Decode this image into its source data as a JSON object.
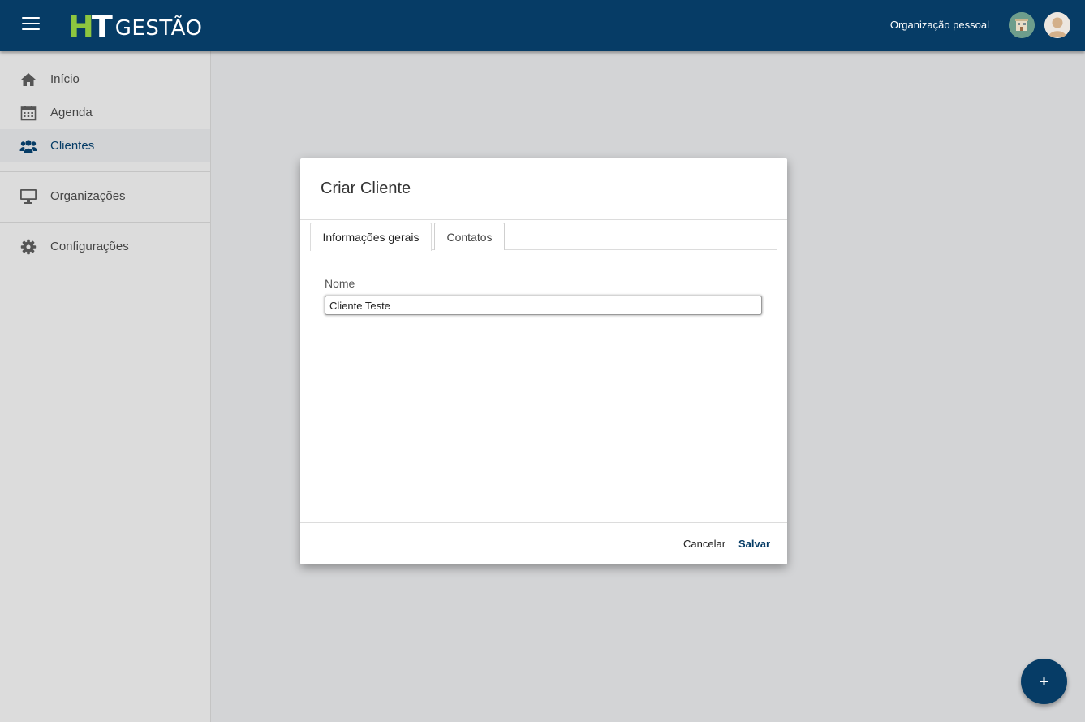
{
  "header": {
    "logo": {
      "part1": "H",
      "part2": "T",
      "part3": "GESTÃO"
    },
    "organization_label": "Organização pessoal",
    "icons": [
      "menu-icon",
      "organization-avatar",
      "user-avatar"
    ]
  },
  "sidebar": {
    "items": [
      {
        "label": "Início",
        "icon": "home-icon"
      },
      {
        "label": "Agenda",
        "icon": "calendar-icon"
      },
      {
        "label": "Clientes",
        "icon": "users-icon",
        "active": true
      },
      {
        "label": "Organizações",
        "icon": "monitor-icon"
      },
      {
        "label": "Configurações",
        "icon": "gear-icon"
      }
    ]
  },
  "dialog": {
    "title": "Criar Cliente",
    "tabs": [
      {
        "label": "Informações gerais",
        "active": true
      },
      {
        "label": "Contatos",
        "active": false
      }
    ],
    "field": {
      "label": "Nome",
      "value": "Cliente Teste"
    },
    "actions": {
      "cancel": "Cancelar",
      "save": "Salvar"
    }
  },
  "fab": {
    "label": "+",
    "icon": "plus-icon"
  },
  "colors": {
    "primary": "#063c66",
    "accent_green": "#8dc63f",
    "background": "#d3d4d6",
    "sidebar": "#dcdcdc"
  }
}
